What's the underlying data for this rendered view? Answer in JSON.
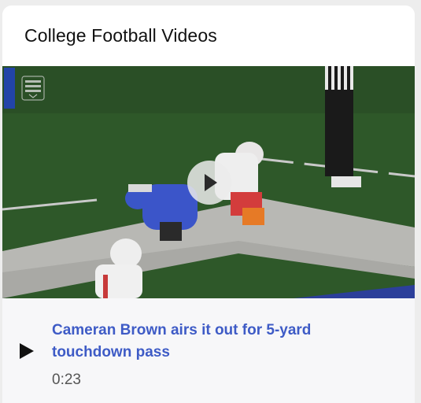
{
  "widget": {
    "title": "College Football Videos"
  },
  "video": {
    "network_logo_icon": "espn-college-football-logo-icon",
    "play_icon": "play-icon",
    "title": "Cameran Brown airs it out for 5-yard touchdown pass",
    "duration": "0:23"
  },
  "colors": {
    "title_link": "#3e5bc6",
    "field_green": "#2f5a2b",
    "info_background": "#f7f7f9"
  }
}
